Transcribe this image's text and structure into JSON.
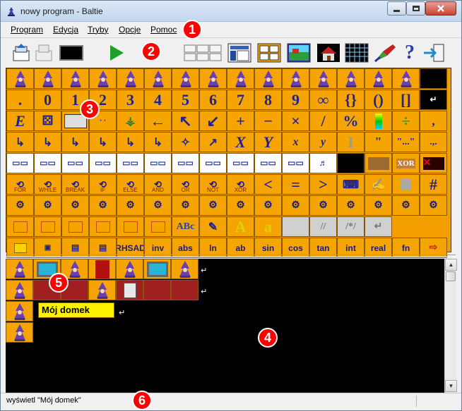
{
  "window": {
    "title": "nowy program - Baltie",
    "controls": {
      "minimize": "minimize",
      "maximize": "maximize",
      "close": "close"
    }
  },
  "menu": {
    "items": [
      {
        "label": "Program"
      },
      {
        "label": "Edycja"
      },
      {
        "label": "Tryby"
      },
      {
        "label": "Opcje"
      },
      {
        "label": "Pomoc"
      }
    ]
  },
  "grid": {
    "row2": [
      ".",
      "0",
      "1",
      "2",
      "3",
      "4",
      "5",
      "6",
      "7",
      "8",
      "9",
      "∞",
      "{}",
      "()",
      "[]"
    ],
    "row3_ops": [
      "+",
      "−",
      "×",
      "/",
      "%"
    ],
    "row7_labels": [
      "FOR",
      "WHILE",
      "BREAK",
      "IF",
      "ELSE",
      "AND",
      "OR",
      "NOT",
      "XOR"
    ],
    "row9_text": [
      "A",
      "a",
      "//",
      "/*/"
    ],
    "row10_labels": [
      "RHSAD",
      "inv",
      "abs",
      "ln",
      "ab",
      "sin",
      "cos",
      "tan",
      "int",
      "real",
      "fn"
    ],
    "xor_label": "XOR"
  },
  "editor": {
    "text_constant": "Mój domek"
  },
  "status": {
    "text": "wyświetl \"Mój domek\""
  },
  "callouts": [
    "1",
    "2",
    "3",
    "4",
    "5",
    "6"
  ],
  "colors": {
    "accent": "#f6a400",
    "callout": "#ff0000",
    "editor_bg": "#000000"
  }
}
